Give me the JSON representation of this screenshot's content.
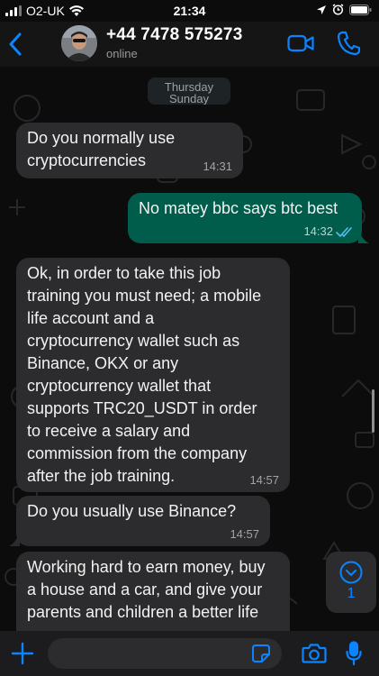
{
  "status_bar": {
    "carrier": "O2-UK",
    "time": "21:34"
  },
  "header": {
    "contact_name": "+44 7478 575273",
    "contact_status": "online",
    "icons": [
      "back-icon",
      "avatar",
      "video-call-icon",
      "voice-call-icon"
    ]
  },
  "date_pill": {
    "label": "Thursday",
    "label_behind": "Sunday"
  },
  "messages": [
    {
      "direction": "in",
      "text": "Do you normally use\ncryptocurrencies",
      "time": "14:31"
    },
    {
      "direction": "out",
      "text": "No matey bbc says btc best",
      "time": "14:32",
      "status": "read"
    },
    {
      "direction": "in",
      "text": "Ok, in order to take this job\ntraining you must need; a mobile\nlife account and a\ncryptocurrency wallet such as\nBinance, OKX or any\ncryptocurrency wallet that\nsupports TRC20_USDT in order\nto receive a salary and\ncommission from the company\nafter the job training.",
      "time": "14:57"
    },
    {
      "direction": "in",
      "text": "Do you usually use Binance?",
      "time": "14:57"
    },
    {
      "direction": "in",
      "text": "Working hard to earn money, buy\na house and a car, and give your\nparents and children a better life",
      "time": ""
    }
  ],
  "scroll_button": {
    "unread_count": "1"
  },
  "composer": {
    "placeholder": ""
  },
  "colors": {
    "accent": "#0a84ff",
    "incoming_bubble": "#2c2c2e",
    "outgoing_bubble": "#005c4b",
    "background": "#0c0c0c"
  }
}
